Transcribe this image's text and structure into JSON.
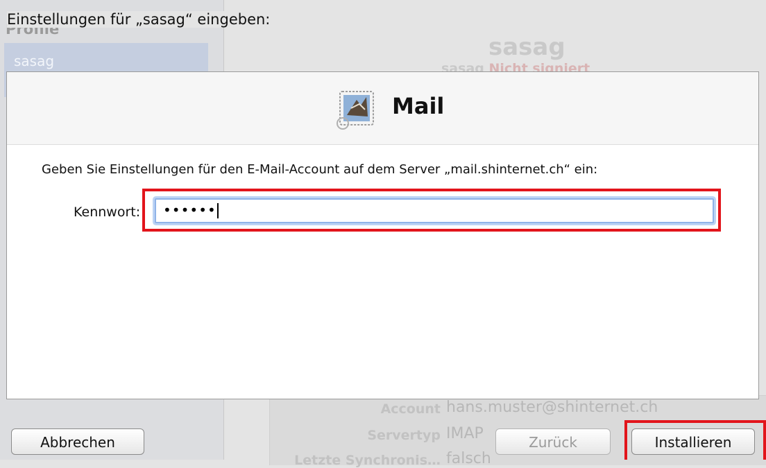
{
  "background_window": {
    "sidebar_heading": "Profile",
    "sidebar_item": "sasag",
    "profile_name": "sasag",
    "profile_status_prefix": "sasag",
    "profile_status": "Nicht signiert",
    "details": [
      {
        "label": "Account",
        "value": "hans.muster@shinternet.ch"
      },
      {
        "label": "Servertyp",
        "value": "IMAP"
      },
      {
        "label": "Letzte Synchronis…",
        "value": "falsch"
      }
    ]
  },
  "sheet": {
    "title": "Einstellungen für „sasag“ eingeben:",
    "app_name": "Mail",
    "app_icon": "mail-stamp-icon",
    "intro": "Geben Sie Einstellungen für den E-Mail-Account auf dem Server „mail.shinternet.ch“ ein:",
    "password_label": "Kennwort:",
    "password_value": "••••••"
  },
  "buttons": {
    "cancel": "Abbrechen",
    "back": "Zurück",
    "install": "Installieren"
  },
  "colors": {
    "highlight": "#e2141b",
    "focus_ring": "#8fb3e8"
  }
}
